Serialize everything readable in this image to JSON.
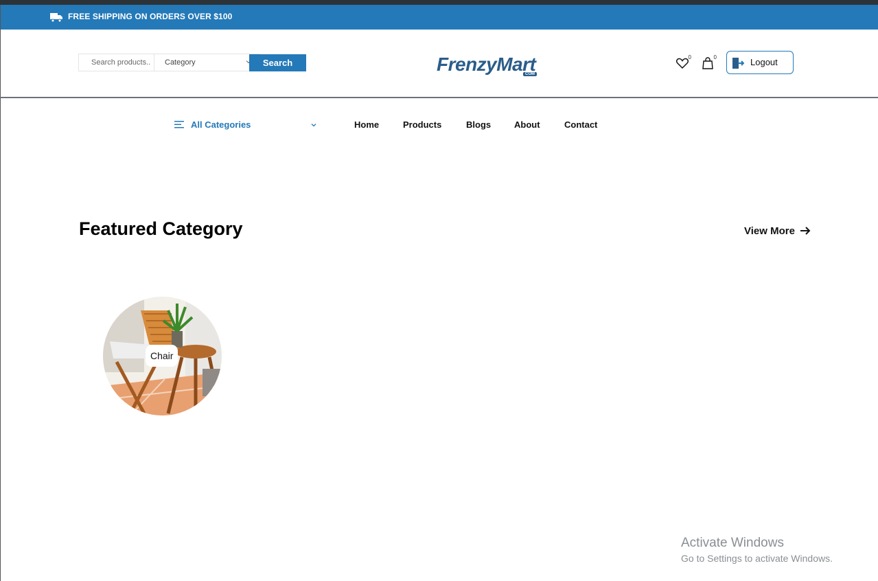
{
  "promo": {
    "text": "FREE SHIPPING ON ORDERS OVER $100",
    "icon": "truck-icon"
  },
  "header": {
    "search_placeholder": "Search products..",
    "category_select": "Category",
    "search_button": "Search",
    "logo_text": "FrenzyMart",
    "logo_sub": "COM",
    "wishlist_count": "0",
    "cart_count": "0",
    "logout_label": "Logout"
  },
  "nav": {
    "all_categories": "All Categories",
    "links": [
      "Home",
      "Products",
      "Blogs",
      "About",
      "Contact"
    ]
  },
  "featured": {
    "title": "Featured Category",
    "view_more": "View More",
    "categories": [
      {
        "label": "Chair"
      }
    ]
  },
  "watermark": {
    "line1": "Activate Windows",
    "line2": "Go to Settings to activate Windows."
  },
  "colors": {
    "brand_blue": "#2479b8",
    "logo_blue": "#2a5d8a",
    "top_strip": "#2c3338"
  }
}
